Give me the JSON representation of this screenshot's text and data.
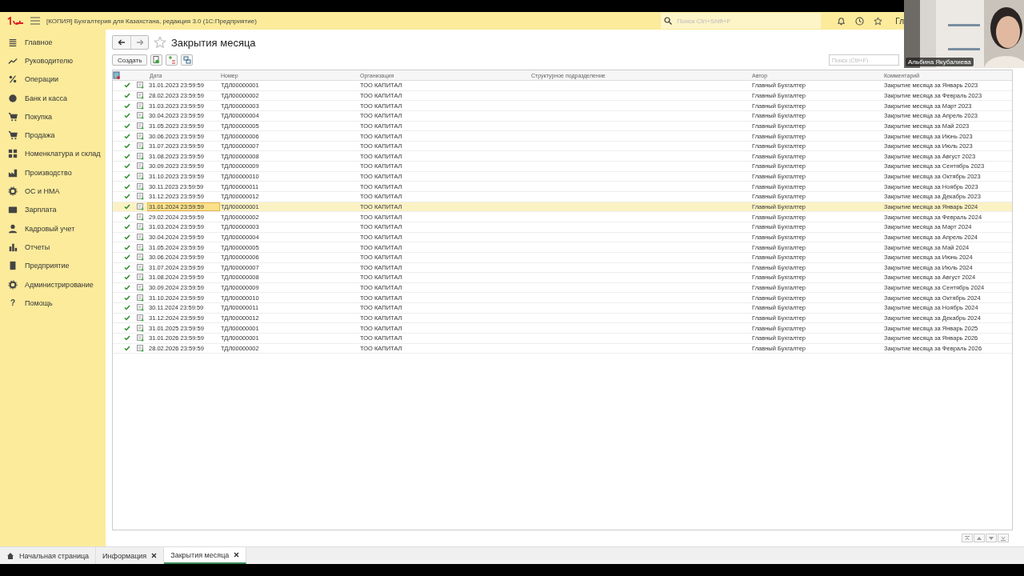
{
  "app_bar": {
    "title": "[КОПИЯ] Бухгалтерия для Казахстана, редакция 3.0  (1С:Предприятие)",
    "search": {
      "placeholder": "Поиск Ctrl+Shift+F"
    },
    "user_text": "Гл"
  },
  "sidebar": {
    "items": [
      {
        "label": "Главное"
      },
      {
        "label": "Руководителю"
      },
      {
        "label": "Операции"
      },
      {
        "label": "Банк и касса"
      },
      {
        "label": "Покупка"
      },
      {
        "label": "Продажа"
      },
      {
        "label": "Номенклатура и склад"
      },
      {
        "label": "Производство"
      },
      {
        "label": "ОС и НМА"
      },
      {
        "label": "Зарплата"
      },
      {
        "label": "Кадровый учет"
      },
      {
        "label": "Отчеты"
      },
      {
        "label": "Предприятие"
      },
      {
        "label": "Администрирование"
      },
      {
        "label": "Помощь",
        "glyph": "?"
      }
    ]
  },
  "form": {
    "title": "Закрытия месяца",
    "create_button": "Создать",
    "search": {
      "placeholder": "Поиск (Ctrl+F)"
    }
  },
  "table": {
    "columns": [
      "Дата",
      "Номер",
      "Организация",
      "Структурное подразделение",
      "Автор",
      "Комментарий"
    ],
    "rows": [
      {
        "date": "31.01.2023 23:59:59",
        "number": "ТДЛ00000001",
        "org": "ТОО КАПИТАЛ",
        "author": "Главный Бухгалтер",
        "comment": "Закрытие месяца за Январь 2023",
        "posted": true,
        "selected": false
      },
      {
        "date": "28.02.2023 23:59:59",
        "number": "ТДЛ00000002",
        "org": "ТОО КАПИТАЛ",
        "author": "Главный Бухгалтер",
        "comment": "Закрытие месяца за Февраль 2023",
        "posted": true,
        "selected": false
      },
      {
        "date": "31.03.2023 23:59:59",
        "number": "ТДЛ00000003",
        "org": "ТОО КАПИТАЛ",
        "author": "Главный Бухгалтер",
        "comment": "Закрытие месяца за Март 2023",
        "posted": true,
        "selected": false
      },
      {
        "date": "30.04.2023 23:59:59",
        "number": "ТДЛ00000004",
        "org": "ТОО КАПИТАЛ",
        "author": "Главный Бухгалтер",
        "comment": "Закрытие месяца за Апрель 2023",
        "posted": true,
        "selected": false
      },
      {
        "date": "31.05.2023 23:59:59",
        "number": "ТДЛ00000005",
        "org": "ТОО КАПИТАЛ",
        "author": "Главный Бухгалтер",
        "comment": "Закрытие месяца за Май 2023",
        "posted": true,
        "selected": false
      },
      {
        "date": "30.06.2023 23:59:59",
        "number": "ТДЛ00000006",
        "org": "ТОО КАПИТАЛ",
        "author": "Главный Бухгалтер",
        "comment": "Закрытие месяца за Июнь 2023",
        "posted": true,
        "selected": false
      },
      {
        "date": "31.07.2023 23:59:59",
        "number": "ТДЛ00000007",
        "org": "ТОО КАПИТАЛ",
        "author": "Главный Бухгалтер",
        "comment": "Закрытие месяца за Июль 2023",
        "posted": true,
        "selected": false
      },
      {
        "date": "31.08.2023 23:59:59",
        "number": "ТДЛ00000008",
        "org": "ТОО КАПИТАЛ",
        "author": "Главный Бухгалтер",
        "comment": "Закрытие месяца за Август 2023",
        "posted": true,
        "selected": false
      },
      {
        "date": "30.09.2023 23:59:59",
        "number": "ТДЛ00000009",
        "org": "ТОО КАПИТАЛ",
        "author": "Главный Бухгалтер",
        "comment": "Закрытие месяца за Сентябрь 2023",
        "posted": true,
        "selected": false
      },
      {
        "date": "31.10.2023 23:59:59",
        "number": "ТДЛ00000010",
        "org": "ТОО КАПИТАЛ",
        "author": "Главный Бухгалтер",
        "comment": "Закрытие месяца за Октябрь 2023",
        "posted": true,
        "selected": false
      },
      {
        "date": "30.11.2023 23:59:59",
        "number": "ТДЛ00000011",
        "org": "ТОО КАПИТАЛ",
        "author": "Главный Бухгалтер",
        "comment": "Закрытие месяца за Ноябрь 2023",
        "posted": true,
        "selected": false
      },
      {
        "date": "31.12.2023 23:59:59",
        "number": "ТДЛ00000012",
        "org": "ТОО КАПИТАЛ",
        "author": "Главный Бухгалтер",
        "comment": "Закрытие месяца за Декабрь 2023",
        "posted": true,
        "selected": false
      },
      {
        "date": "31.01.2024 23:59:59",
        "number": "ТДЛ00000001",
        "org": "ТОО КАПИТАЛ",
        "author": "Главный Бухгалтер",
        "comment": "Закрытие месяца за Январь 2024",
        "posted": true,
        "selected": true
      },
      {
        "date": "29.02.2024 23:59:59",
        "number": "ТДЛ00000002",
        "org": "ТОО КАПИТАЛ",
        "author": "Главный Бухгалтер",
        "comment": "Закрытие месяца за Февраль 2024",
        "posted": true,
        "selected": false
      },
      {
        "date": "31.03.2024 23:59:59",
        "number": "ТДЛ00000003",
        "org": "ТОО КАПИТАЛ",
        "author": "Главный Бухгалтер",
        "comment": "Закрытие месяца за Март 2024",
        "posted": true,
        "selected": false
      },
      {
        "date": "30.04.2024 23:59:59",
        "number": "ТДЛ00000004",
        "org": "ТОО КАПИТАЛ",
        "author": "Главный Бухгалтер",
        "comment": "Закрытие месяца за Апрель 2024",
        "posted": true,
        "selected": false
      },
      {
        "date": "31.05.2024 23:59:59",
        "number": "ТДЛ00000005",
        "org": "ТОО КАПИТАЛ",
        "author": "Главный Бухгалтер",
        "comment": "Закрытие месяца за Май 2024",
        "posted": true,
        "selected": false
      },
      {
        "date": "30.06.2024 23:59:59",
        "number": "ТДЛ00000006",
        "org": "ТОО КАПИТАЛ",
        "author": "Главный Бухгалтер",
        "comment": "Закрытие месяца за Июнь 2024",
        "posted": true,
        "selected": false
      },
      {
        "date": "31.07.2024 23:59:59",
        "number": "ТДЛ00000007",
        "org": "ТОО КАПИТАЛ",
        "author": "Главный Бухгалтер",
        "comment": "Закрытие месяца за Июль 2024",
        "posted": true,
        "selected": false
      },
      {
        "date": "31.08.2024 23:59:59",
        "number": "ТДЛ00000008",
        "org": "ТОО КАПИТАЛ",
        "author": "Главный Бухгалтер",
        "comment": "Закрытие месяца за Август 2024",
        "posted": true,
        "selected": false
      },
      {
        "date": "30.09.2024 23:59:59",
        "number": "ТДЛ00000009",
        "org": "ТОО КАПИТАЛ",
        "author": "Главный Бухгалтер",
        "comment": "Закрытие месяца за Сентябрь 2024",
        "posted": true,
        "selected": false
      },
      {
        "date": "31.10.2024 23:59:59",
        "number": "ТДЛ00000010",
        "org": "ТОО КАПИТАЛ",
        "author": "Главный Бухгалтер",
        "comment": "Закрытие месяца за Октябрь 2024",
        "posted": true,
        "selected": false
      },
      {
        "date": "30.11.2024 23:59:59",
        "number": "ТДЛ00000011",
        "org": "ТОО КАПИТАЛ",
        "author": "Главный Бухгалтер",
        "comment": "Закрытие месяца за Ноябрь 2024",
        "posted": true,
        "selected": false
      },
      {
        "date": "31.12.2024 23:59:59",
        "number": "ТДЛ00000012",
        "org": "ТОО КАПИТАЛ",
        "author": "Главный Бухгалтер",
        "comment": "Закрытие месяца за Декабрь 2024",
        "posted": true,
        "selected": false
      },
      {
        "date": "31.01.2025 23:59:59",
        "number": "ТДЛ00000001",
        "org": "ТОО КАПИТАЛ",
        "author": "Главный Бухгалтер",
        "comment": "Закрытие месяца за Январь 2025",
        "posted": true,
        "selected": false
      },
      {
        "date": "31.01.2026 23:59:59",
        "number": "ТДЛ00000001",
        "org": "ТОО КАПИТАЛ",
        "author": "Главный Бухгалтер",
        "comment": "Закрытие месяца за Январь 2026",
        "posted": true,
        "selected": false
      },
      {
        "date": "28.02.2026 23:59:59",
        "number": "ТДЛ00000002",
        "org": "ТОО КАПИТАЛ",
        "author": "Главный Бухгалтер",
        "comment": "Закрытие месяца за Февраль 2026",
        "posted": true,
        "selected": false
      }
    ]
  },
  "open_tabs": [
    {
      "label": "Начальная страница",
      "kind": "home",
      "selected": false
    },
    {
      "label": "Информация",
      "kind": "closable",
      "selected": false
    },
    {
      "label": "Закрытия месяца",
      "kind": "closable",
      "selected": true
    }
  ],
  "video_overlay": {
    "kind": "picture",
    "name": "Альбина Якубалиева"
  }
}
